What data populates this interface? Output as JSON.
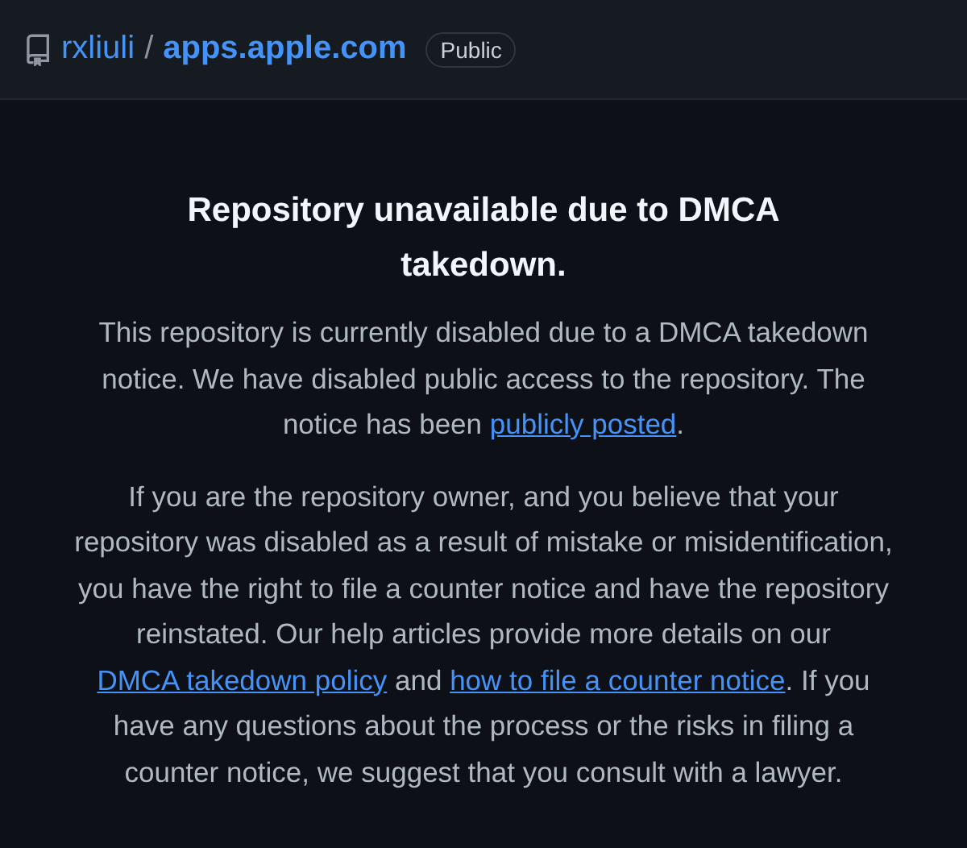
{
  "header": {
    "owner": "rxliuli",
    "separator": "/",
    "repo": "apps.apple.com",
    "visibility": "Public"
  },
  "notice": {
    "title": "Repository unavailable due to DMCA takedown.",
    "paragraphs": [
      [
        {
          "kind": "text",
          "text": "This repository is currently disabled due to a DMCA takedown notice. We have disabled public access to the repository. The notice has been "
        },
        {
          "kind": "link",
          "text": "publicly posted"
        },
        {
          "kind": "text",
          "text": "."
        }
      ],
      [
        {
          "kind": "text",
          "text": "If you are the repository owner, and you believe that your repository was disabled as a result of mistake or misidentification, you have the right to file a counter notice and have the repository reinstated. Our help articles provide more details on our "
        },
        {
          "kind": "link",
          "text": "DMCA takedown policy"
        },
        {
          "kind": "text",
          "text": " and "
        },
        {
          "kind": "link",
          "text": "how to file a counter notice"
        },
        {
          "kind": "text",
          "text": ". If you have any questions about the process or the risks in filing a counter notice, we suggest that you consult with a lawyer."
        }
      ]
    ]
  }
}
